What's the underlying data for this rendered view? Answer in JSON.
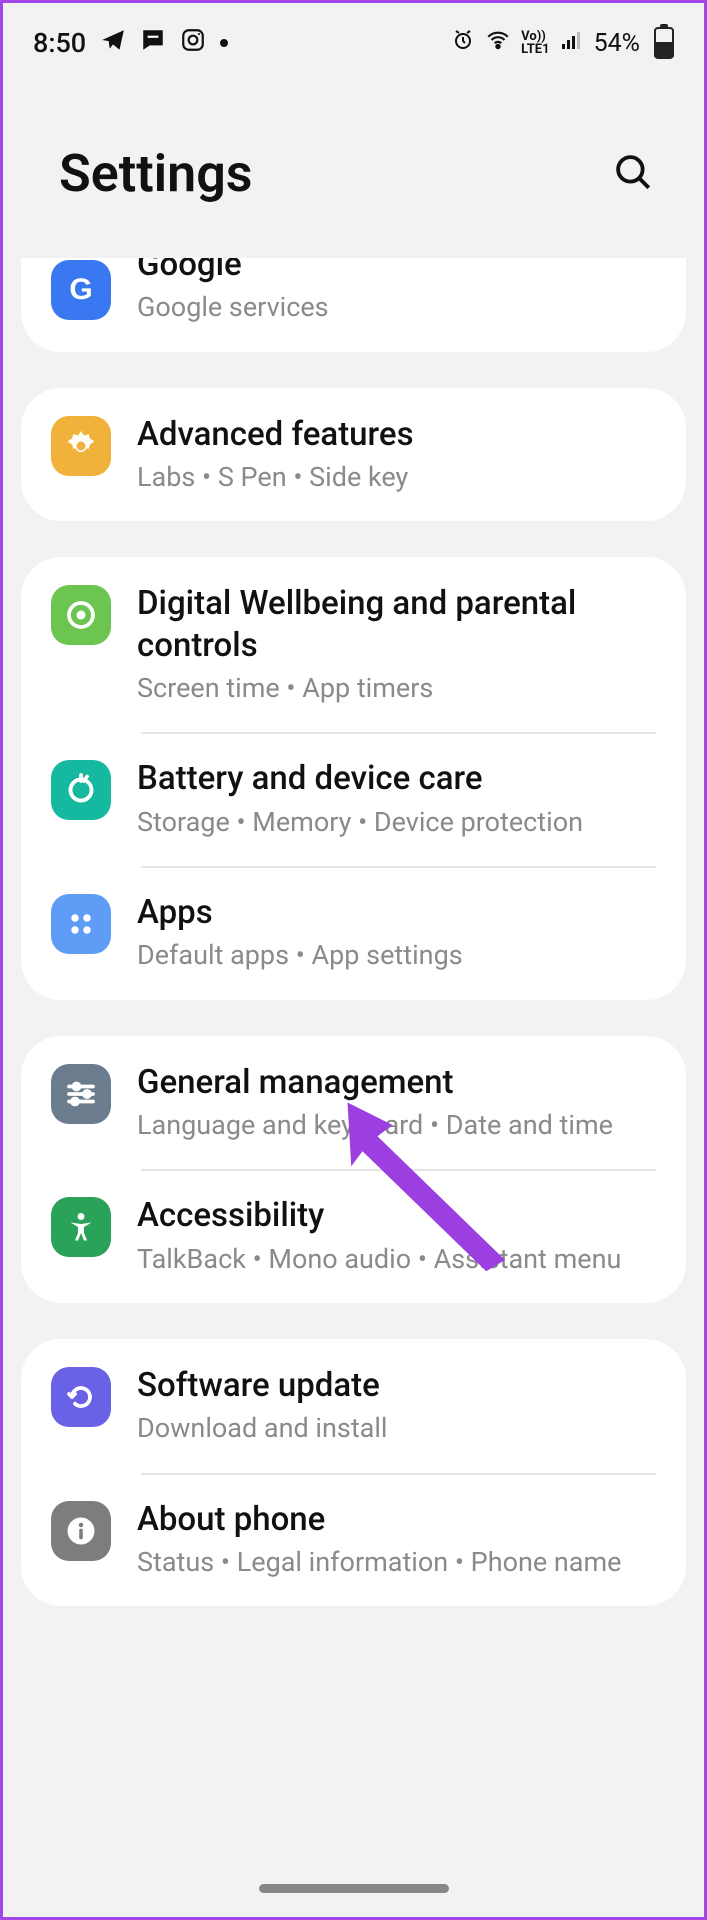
{
  "status": {
    "time": "8:50",
    "battery_text": "54%"
  },
  "header": {
    "title": "Settings"
  },
  "groups": [
    {
      "items": [
        {
          "name": "google",
          "title": "Google",
          "subtitle": "Google services",
          "icon": "google"
        }
      ]
    },
    {
      "items": [
        {
          "name": "advanced-features",
          "title": "Advanced features",
          "subtitle": "Labs  •  S Pen  •  Side key",
          "icon": "advanced"
        }
      ]
    },
    {
      "items": [
        {
          "name": "digital-wellbeing",
          "title": "Digital Wellbeing and parental controls",
          "subtitle": "Screen time  •  App timers",
          "icon": "wellbeing"
        },
        {
          "name": "battery-care",
          "title": "Battery and device care",
          "subtitle": "Storage  •  Memory  •  Device protection",
          "icon": "battery"
        },
        {
          "name": "apps",
          "title": "Apps",
          "subtitle": "Default apps  •  App settings",
          "icon": "apps"
        }
      ]
    },
    {
      "items": [
        {
          "name": "general-management",
          "title": "General management",
          "subtitle": "Language and keyboard  •  Date and time",
          "icon": "general"
        },
        {
          "name": "accessibility",
          "title": "Accessibility",
          "subtitle": "TalkBack  •  Mono audio  •  Assistant menu",
          "icon": "access"
        }
      ]
    },
    {
      "items": [
        {
          "name": "software-update",
          "title": "Software update",
          "subtitle": "Download and install",
          "icon": "software"
        },
        {
          "name": "about-phone",
          "title": "About phone",
          "subtitle": "Status  •  Legal information  •  Phone name",
          "icon": "about"
        }
      ]
    }
  ]
}
